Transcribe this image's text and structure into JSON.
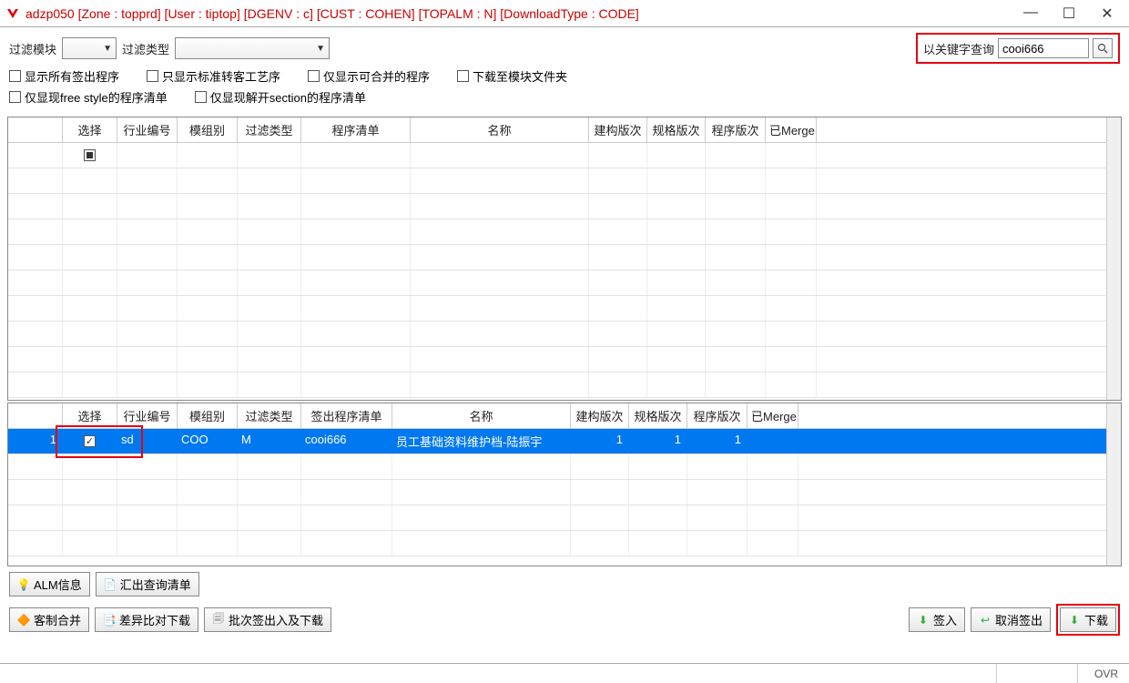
{
  "window": {
    "title": "adzp050 [Zone : topprd]  [User : tiptop]  [DGENV : c]  [CUST : COHEN]  [TOPALM : N]  [DownloadType : CODE]"
  },
  "filters": {
    "module_label": "过滤模块",
    "module_value": "",
    "type_label": "过滤类型",
    "type_value": ""
  },
  "search": {
    "label": "以关键字查询",
    "value": "cooi666"
  },
  "checkboxes": {
    "show_all_checkout": "显示所有签出程序",
    "only_std_proc": "只显示标准转客工艺序",
    "only_mergeable": "仅显示可合并的程序",
    "download_to_module": "下载至模块文件夹",
    "only_freestyle": "仅显现free style的程序清单",
    "only_section": "仅显现解开section的程序清单"
  },
  "columns": {
    "select": "选择",
    "industry": "行业编号",
    "module": "模组别",
    "filter_type": "过滤类型",
    "program_list": "程序清单",
    "checkout_program_list": "签出程序清单",
    "name": "名称",
    "build_ver": "建构版次",
    "spec_ver": "规格版次",
    "prog_ver": "程序版次",
    "merged": "已Merge"
  },
  "table_top": {
    "rows": []
  },
  "table_bottom": {
    "rows": [
      {
        "rownum": "1",
        "selected": true,
        "industry": "sd",
        "module": "COO",
        "filter_type": "M",
        "program": "cooi666",
        "name": "员工基础资料维护档-陆振宇",
        "build_ver": "1",
        "spec_ver": "1",
        "prog_ver": "1",
        "merged": ""
      }
    ]
  },
  "buttons": {
    "alm_info": "ALM信息",
    "export_query": "汇出查询清单",
    "customer_merge": "客制合并",
    "diff_download": "差异比对下载",
    "batch_checkout": "批次签出入及下载",
    "checkin": "签入",
    "cancel_checkout": "取消签出",
    "download": "下载"
  },
  "status": {
    "mode": "OVR"
  },
  "icons": {
    "search": "search-icon",
    "caret": "caret-down-icon"
  }
}
